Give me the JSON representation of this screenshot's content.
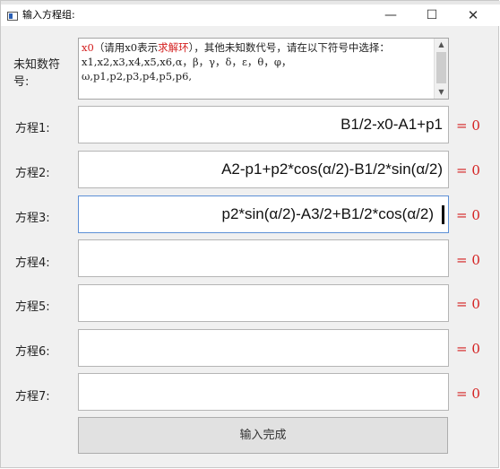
{
  "window": {
    "title": "输入方程组:",
    "min_glyph": "—",
    "max_glyph": "☐",
    "close_glyph": "✕"
  },
  "unknowns": {
    "label": "未知数符号:",
    "text_seg1": "x0",
    "text_seg2": "（请用x0表示",
    "text_seg3": "求解环",
    "text_seg4": "），其他未知数代号，请在以下符号中选择：",
    "text_line2": "x1,x2,x3,x4,x5,x6,α，β，γ，δ，ε，θ，φ，",
    "text_line3": "ω,p1,p2,p3,p4,p5,p6,"
  },
  "equations": [
    {
      "label": "方程1:",
      "value": "B1/2-x0-A1+p1",
      "rhs": "= 0"
    },
    {
      "label": "方程2:",
      "value": "A2-p1+p2*cos(α/2)-B1/2*sin(α/2)",
      "rhs": "= 0"
    },
    {
      "label": "方程3:",
      "value": "p2*sin(α/2)-A3/2+B1/2*cos(α/2)",
      "rhs": "= 0"
    },
    {
      "label": "方程4:",
      "value": "",
      "rhs": "= 0"
    },
    {
      "label": "方程5:",
      "value": "",
      "rhs": "= 0"
    },
    {
      "label": "方程6:",
      "value": "",
      "rhs": "= 0"
    },
    {
      "label": "方程7:",
      "value": "",
      "rhs": "= 0"
    }
  ],
  "done_button": "输入完成"
}
